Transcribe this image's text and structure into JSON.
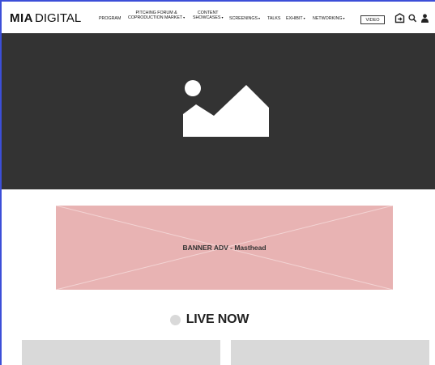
{
  "header": {
    "logo": {
      "bold": "MIA",
      "light": "DIGITAL"
    },
    "nav": [
      {
        "lines": [
          "PROGRAM"
        ],
        "caret": false
      },
      {
        "lines": [
          "PITCHING FORUM &",
          "COPRODUCTION MARKET"
        ],
        "caret": true
      },
      {
        "lines": [
          "CONTENT",
          "SHOWCASES"
        ],
        "caret": true
      },
      {
        "lines": [
          "SCREENINGS"
        ],
        "caret": true
      },
      {
        "lines": [
          "TALKS"
        ],
        "caret": false
      },
      {
        "lines": [
          "EXHIBIT"
        ],
        "caret": true
      },
      {
        "lines": [
          "NETWORKING"
        ],
        "caret": true
      }
    ],
    "caret_glyph": "▾",
    "video_label": "VIDEO",
    "icons": [
      "login-icon",
      "search-icon",
      "user-icon"
    ]
  },
  "hero": {
    "icon": "image-placeholder-icon",
    "background": "#333333"
  },
  "banner": {
    "label": "BANNER ADV - Masthead",
    "color": "#e8b3b3"
  },
  "live": {
    "title": "LIVE NOW",
    "dot_color": "#d9d9d9"
  },
  "cards": [
    {},
    {}
  ]
}
